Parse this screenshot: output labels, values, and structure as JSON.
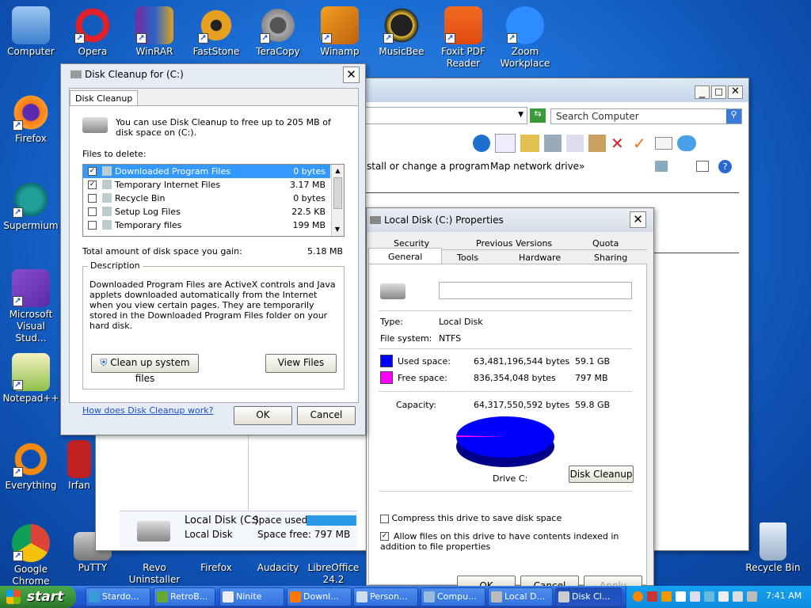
{
  "desktop": {
    "icons": [
      "Computer",
      "Opera",
      "WinRAR",
      "FastStone",
      "TeraCopy",
      "Winamp",
      "MusicBee",
      "Foxit PDF",
      "Reader",
      "Zoom",
      "Workplace",
      "Firefox",
      "Supermium",
      "Microsoft",
      "Visual Stud...",
      "Notepad++",
      "Everything",
      "Irfan",
      "Google",
      "Chrome",
      "PuTTY",
      "Revo",
      "Uninstaller",
      "Firefox",
      "Audacity",
      "LibreOffice",
      "24.2",
      "Recycle Bin"
    ]
  },
  "explorer": {
    "search_placeholder": "Search Computer",
    "links": [
      "stall or change a program",
      "Map network drive",
      "»"
    ],
    "drive_name": "Local Disk (C:)",
    "drive_type": "Local Disk",
    "space_used_label": "Space used:",
    "space_free": "Space free: 797 MB",
    "used_fraction": 0.987
  },
  "cleanup": {
    "title": "Disk Cleanup for  (C:)",
    "tab": "Disk Cleanup",
    "intro": "You can use Disk Cleanup to free up to 205 MB of disk space on  (C:).",
    "files_label": "Files to delete:",
    "files": [
      {
        "name": "Downloaded Program Files",
        "size": "0 bytes",
        "checked": true
      },
      {
        "name": "Temporary Internet Files",
        "size": "3.17 MB",
        "checked": true
      },
      {
        "name": "Recycle Bin",
        "size": "0 bytes",
        "checked": false
      },
      {
        "name": "Setup Log Files",
        "size": "22.5 KB",
        "checked": false
      },
      {
        "name": "Temporary files",
        "size": "199 MB",
        "checked": false
      }
    ],
    "total_label": "Total amount of disk space you gain:",
    "total_value": "5.18 MB",
    "desc_title": "Description",
    "desc": "Downloaded Program Files are ActiveX controls and Java applets downloaded automatically from the Internet when you view certain pages. They are temporarily stored in the Downloaded Program Files folder on your hard disk.",
    "btn_system": "Clean up system files",
    "btn_view": "View Files",
    "link": "How does Disk Cleanup work?",
    "ok": "OK",
    "cancel": "Cancel"
  },
  "props": {
    "title": "Local Disk (C:) Properties",
    "tabs_row1": [
      "Security",
      "Previous Versions",
      "Quota"
    ],
    "tabs_row2": [
      "General",
      "Tools",
      "Hardware",
      "Sharing"
    ],
    "name_value": "",
    "type_label": "Type:",
    "type_value": "Local Disk",
    "fs_label": "File system:",
    "fs_value": "NTFS",
    "used_label": "Used space:",
    "used_bytes": "63,481,196,544 bytes",
    "used_gb": "59.1 GB",
    "free_label": "Free space:",
    "free_bytes": "836,354,048 bytes",
    "free_gb": "797 MB",
    "cap_label": "Capacity:",
    "cap_bytes": "64,317,550,592 bytes",
    "cap_gb": "59.8 GB",
    "drive_label": "Drive C:",
    "btn_cleanup": "Disk Cleanup",
    "compress": "Compress this drive to save disk space",
    "index": "Allow files on this drive to have contents indexed in addition to file properties",
    "index_checked": true,
    "ok": "OK",
    "cancel": "Cancel",
    "apply": "Apply",
    "used_color": "#0000ff",
    "free_color": "#ff00ff"
  },
  "taskbar": {
    "start": "start",
    "tasks": [
      "Stardo...",
      "RetroB...",
      "Ninite",
      "Downl...",
      "Person...",
      "Compu...",
      "Local D...",
      "Disk Cl..."
    ],
    "time": "7:41 AM"
  }
}
